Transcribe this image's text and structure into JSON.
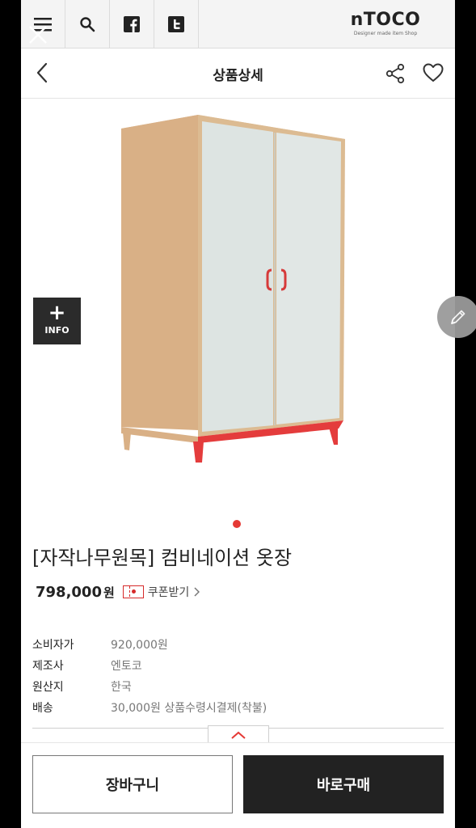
{
  "topbar": {
    "logo": "nTOCO",
    "logo_sub": "Designer made item Shop"
  },
  "header": {
    "title": "상품상세"
  },
  "image": {
    "info_label": "INFO",
    "active_dot_color": "#e53935"
  },
  "product": {
    "name": "[자작나무원목] 컴비네이션 옷장",
    "price": "798,000",
    "price_unit": "원",
    "coupon_label": "쿠폰받기",
    "specs": [
      {
        "label": "소비자가",
        "value": "920,000원"
      },
      {
        "label": "제조사",
        "value": "엔토코"
      },
      {
        "label": "원산지",
        "value": "한국"
      },
      {
        "label": "배송",
        "value": "30,000원 상품수령시결제(착불)"
      }
    ]
  },
  "actions": {
    "cart_label": "장바구니",
    "buy_label": "바로구매"
  },
  "colors": {
    "accent": "#e53935",
    "dark": "#222222"
  }
}
